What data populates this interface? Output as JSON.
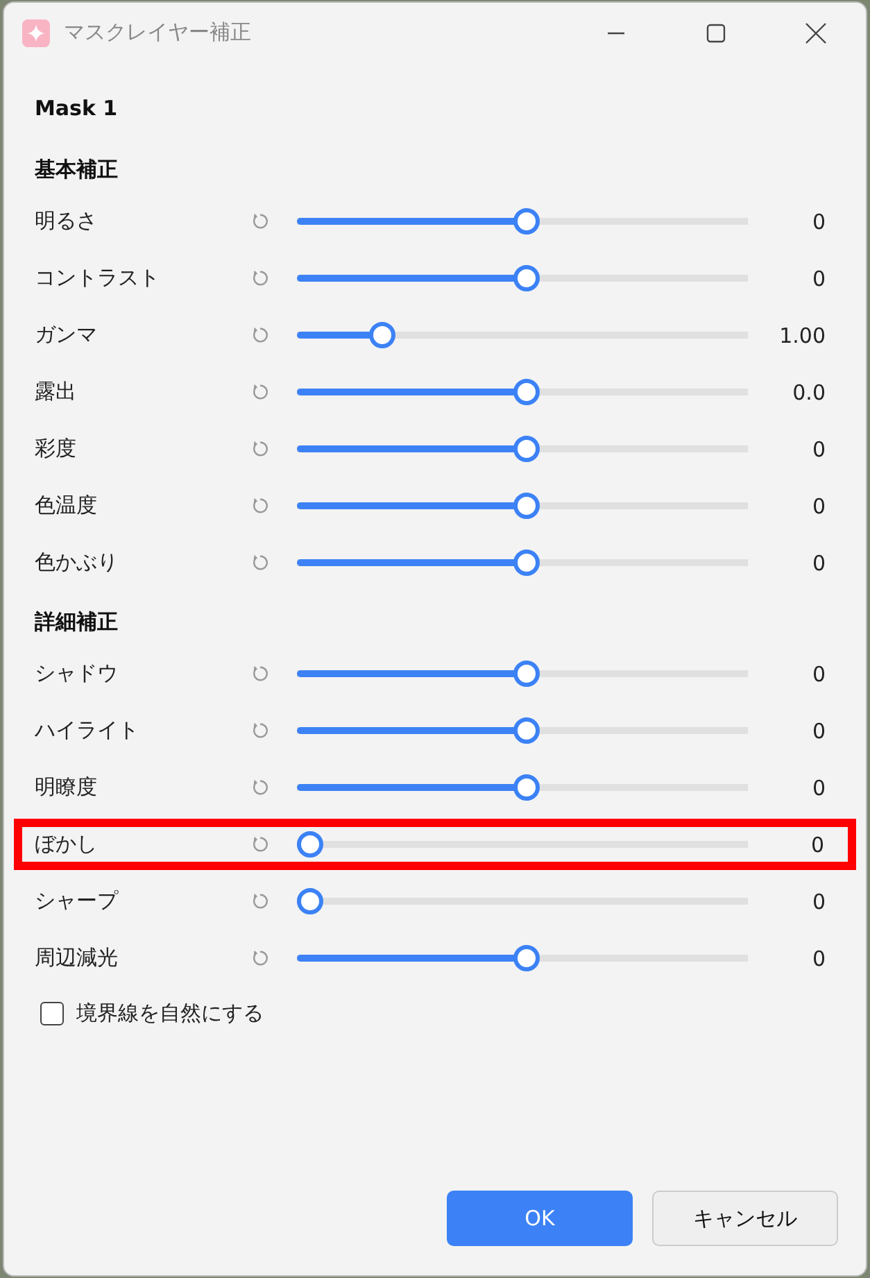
{
  "window": {
    "title": "マスクレイヤー補正"
  },
  "mask_name": "Mask 1",
  "sections": [
    {
      "title": "基本補正",
      "sliders": [
        {
          "label": "明るさ",
          "level": 0.5,
          "value": "0",
          "highlighted": false
        },
        {
          "label": "コントラスト",
          "level": 0.5,
          "value": "0",
          "highlighted": false
        },
        {
          "label": "ガンマ",
          "level": 0.18,
          "value": "1.00",
          "highlighted": false
        },
        {
          "label": "露出",
          "level": 0.5,
          "value": "0.0",
          "highlighted": false
        },
        {
          "label": "彩度",
          "level": 0.5,
          "value": "0",
          "highlighted": false
        },
        {
          "label": "色温度",
          "level": 0.5,
          "value": "0",
          "highlighted": false
        },
        {
          "label": "色かぶり",
          "level": 0.5,
          "value": "0",
          "highlighted": false
        }
      ]
    },
    {
      "title": "詳細補正",
      "sliders": [
        {
          "label": "シャドウ",
          "level": 0.5,
          "value": "0",
          "highlighted": false
        },
        {
          "label": "ハイライト",
          "level": 0.5,
          "value": "0",
          "highlighted": false
        },
        {
          "label": "明瞭度",
          "level": 0.5,
          "value": "0",
          "highlighted": false
        },
        {
          "label": "ぼかし",
          "level": 0.02,
          "value": "0",
          "highlighted": true
        },
        {
          "label": "シャープ",
          "level": 0.02,
          "value": "0",
          "highlighted": false
        },
        {
          "label": "周辺減光",
          "level": 0.5,
          "value": "0",
          "highlighted": false
        }
      ]
    }
  ],
  "checkbox": {
    "label": "境界線を自然にする",
    "checked": false
  },
  "buttons": [
    {
      "label": "OK",
      "kind": "primary"
    },
    {
      "label": "キャンセル",
      "kind": "secondary"
    }
  ]
}
